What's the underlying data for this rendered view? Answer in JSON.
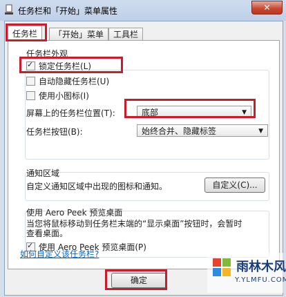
{
  "window": {
    "title": "任务栏和「开始」菜单属性",
    "close_glyph": "✕"
  },
  "tabs": [
    "任务栏",
    "「开始」菜单",
    "工具栏"
  ],
  "appearance": {
    "group_title": "任务栏外观",
    "lock_label": "锁定任务栏(L)",
    "lock_checked": true,
    "autohide_label": "自动隐藏任务栏(U)",
    "autohide_checked": false,
    "small_icons_label": "使用小图标(I)",
    "small_icons_checked": false,
    "location_label": "屏幕上的任务栏位置(T):",
    "location_value": "底部",
    "buttons_label": "任务栏按钮(B):",
    "buttons_value": "始终合并、隐藏标签"
  },
  "notification": {
    "group_title": "通知区域",
    "description": "自定义通知区域中出现的图标和通知。",
    "customize_button": "自定义(C)..."
  },
  "aero": {
    "group_title": "使用 Aero Peek 预览桌面",
    "description_line1": "当您将鼠标移动到任务栏末端的“显示桌面”按钮时，会暂时",
    "description_line2": "查看桌面。",
    "checkbox_label": "使用 Aero Peek 预览桌面(P)",
    "checkbox_checked": true
  },
  "help_link": "如何自定义该任务栏?",
  "ok_button": "确定",
  "watermark": {
    "main": "雨林木风",
    "sub": "Y.YLMFU.COM"
  },
  "colors": {
    "highlight": "#cc1b2a",
    "link": "#0066cc"
  }
}
